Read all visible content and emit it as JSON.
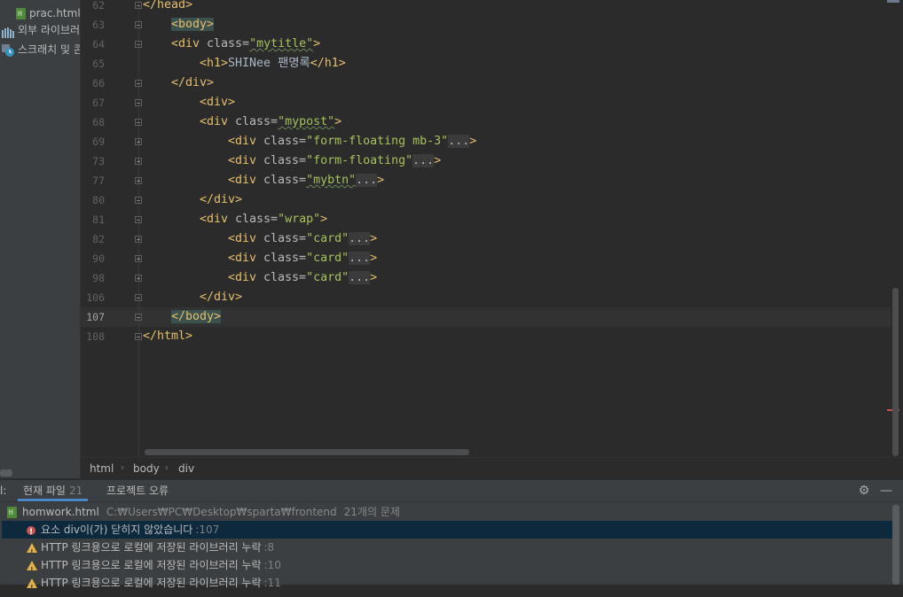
{
  "sidebar": {
    "items": [
      {
        "label": "prac.html"
      },
      {
        "label": "외부 라이브러리"
      },
      {
        "label": "스크래치 및 콘솔"
      }
    ]
  },
  "editor": {
    "lines": [
      {
        "num": "62"
      },
      {
        "num": "63"
      },
      {
        "num": "64"
      },
      {
        "num": "65"
      },
      {
        "num": "66"
      },
      {
        "num": "67"
      },
      {
        "num": "68"
      },
      {
        "num": "69"
      },
      {
        "num": "73"
      },
      {
        "num": "77"
      },
      {
        "num": "80"
      },
      {
        "num": "81"
      },
      {
        "num": "82"
      },
      {
        "num": "90"
      },
      {
        "num": "98"
      },
      {
        "num": "106"
      },
      {
        "num": "107"
      },
      {
        "num": "108"
      }
    ],
    "code": {
      "l62": "</head>",
      "l63": "<body>",
      "l64_open": "<div ",
      "l64_attr": "class=",
      "l64_val": "\"mytitle\"",
      "l64_close": ">",
      "l65_open": "<h1>",
      "l65_text": "SHINee 팬명록",
      "l65_close": "</h1>",
      "l66": "</div>",
      "l67": "<div>",
      "l68_open": "<div ",
      "l68_attr": "class=",
      "l68_val": "\"mypost\"",
      "l68_close": ">",
      "l69_open": "<div ",
      "l69_attr": "class=",
      "l69_val": "\"form-floating mb-3\"",
      "l73_open": "<div ",
      "l73_attr": "class=",
      "l73_val": "\"form-floating\"",
      "l77_open": "<div ",
      "l77_attr": "class=",
      "l77_val": "\"mybtn\"",
      "l80": "</div>",
      "l81_open": "<div ",
      "l81_attr": "class=",
      "l81_val": "\"wrap\"",
      "l81_close": ">",
      "l82_open": "<div ",
      "l82_attr": "class=",
      "l82_val": "\"card\"",
      "l90_open": "<div ",
      "l90_attr": "class=",
      "l90_val": "\"card\"",
      "l98_open": "<div ",
      "l98_attr": "class=",
      "l98_val": "\"card\"",
      "l106": "</div>",
      "l107": "</body>",
      "l108": "</html>",
      "fold_placeholder": "...",
      "gt": ">"
    }
  },
  "breadcrumb": [
    "html",
    "body",
    "div"
  ],
  "problems": {
    "left_fragment": "l:",
    "tabs": [
      {
        "label": "현재 파일",
        "count": "21"
      },
      {
        "label": "프로젝트 오류"
      }
    ],
    "file": {
      "name": "homwork.html",
      "path": "C:₩Users₩PC₩Desktop₩sparta₩frontend",
      "count": "21개의 문제"
    },
    "rows": [
      {
        "text": "요소 div이(가) 닫히지 않았습니다",
        "line": ":107"
      },
      {
        "text": "HTTP 링크용으로 로컬에 저장된 라이브러리 누락",
        "line": ":8"
      },
      {
        "text": "HTTP 링크용으로 로컬에 저장된 라이브러리 누락",
        "line": ":10"
      },
      {
        "text": "HTTP 링크용으로 로컬에 저장된 라이브러리 누락",
        "line": ":11"
      }
    ]
  }
}
